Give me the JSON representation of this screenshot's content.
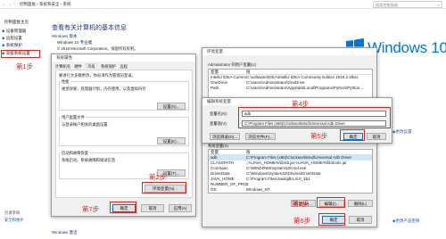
{
  "explorer": {
    "breadcrumb": [
      "控制面板",
      "系统和安全",
      "系统"
    ],
    "search_placeholder": "搜索控制面板"
  },
  "sidebar": {
    "home": "控制面板主页",
    "items": [
      "设备管理器",
      "远程设置",
      "系统保护",
      "高级系统设置"
    ],
    "see_also": "另请参阅",
    "security": "安全和维护"
  },
  "main": {
    "heading": "查看有关计算机的基本信息",
    "edition_label": "Windows 版本",
    "edition": "Windows 10 专业版",
    "copyright": "© 2018 Microsoft Corporation。保留所有权利。",
    "logo_text": "Windows 10",
    "change_settings": "更改设置",
    "change_key": "更改产品密钥"
  },
  "sysprops": {
    "title": "系统属性",
    "tabs": [
      "计算机名",
      "硬件",
      "高级",
      "系统保护",
      "远程"
    ],
    "admin_note": "要进行大多数更改，你必须作为管理员登录。",
    "perf_title": "性能",
    "perf_desc": "视觉效果，处理器计划，内存使用，以及虚拟内存",
    "profile_title": "用户配置文件",
    "profile_desc": "与登录帐户相关的桌面设置",
    "startup_title": "启动和故障恢复",
    "startup_desc": "系统启动、系统故障和调试信息",
    "settings_btn": "设置(S)...",
    "settings_btn2": "设置(E)...",
    "settings_btn3": "设置(T)...",
    "env_btn": "环境变量(N)...",
    "ok": "确定",
    "cancel": "取消",
    "apply": "应用(A)"
  },
  "envvars": {
    "title": "环境变量",
    "user_section": "Administrator 的用户变量(U)",
    "col_var": "变量",
    "col_val": "值",
    "user_rows": [
      {
        "name": "IntelliJ IDEA Community ...",
        "value": "C:\\software\\IDEA\\IntelliJ IDEA Community Edition 2019.2.3\\bin;"
      },
      {
        "name": "OneDrive",
        "value": "C:\\Users\\Administrator\\OneDrive"
      },
      {
        "name": "Path",
        "value": "C:\\Users\\Administrator\\AppData\\Local\\Programs\\Python\\Python..."
      }
    ],
    "sys_section": "系统变量(S)",
    "sys_rows": [
      {
        "name": "adb",
        "value": "C:\\Program Files (x86)\\ClockworkMod\\Universal Adb Driver"
      },
      {
        "name": "CLASSPATH",
        "value": ".;%JAVA_HOME%\\lib\\dt.jar;%JAVA_HOME%\\lib\\tools.jar"
      },
      {
        "name": "ComSpec",
        "value": "C:\\WINDOWS\\system32\\cmd.exe"
      },
      {
        "name": "DriverData",
        "value": "C:\\Windows\\System32\\Drivers\\DriverData"
      },
      {
        "name": "JAVA_HOME",
        "value": "C:\\Program Files\\Java\\jdk1.8.0_151"
      },
      {
        "name": "NUMBER_OF_PROCESSORS",
        "value": "8"
      },
      {
        "name": "OS",
        "value": "Windows_NT"
      }
    ],
    "new_btn": "新建(W)...",
    "edit_btn": "编辑(I)...",
    "delete_btn": "删除(L)",
    "ok": "确定",
    "cancel": "取消"
  },
  "editvar": {
    "title": "编辑系统变量",
    "name_label": "变量名(N):",
    "name_value": "adb",
    "value_label": "变量值(V):",
    "value_value": "C:\\Program Files (x86)\\ClockworkMod\\Universal Adb Driver",
    "browse_dir": "浏览目录(D)...",
    "browse_file": "浏览文件(F)...",
    "ok": "确定",
    "cancel": "取消"
  },
  "steps": {
    "s1": "第1步",
    "s2": "第2步",
    "s3": "第3步",
    "s4": "第4步",
    "s5": "第5步",
    "s6": "第6步",
    "s7": "第7步"
  },
  "bottom": {
    "security": "安全和维护",
    "activation": "Windows 激活"
  },
  "colors": {
    "annotation_red": "#e8221b",
    "windows_blue": "#0078d7",
    "selection": "#cce8ff"
  }
}
